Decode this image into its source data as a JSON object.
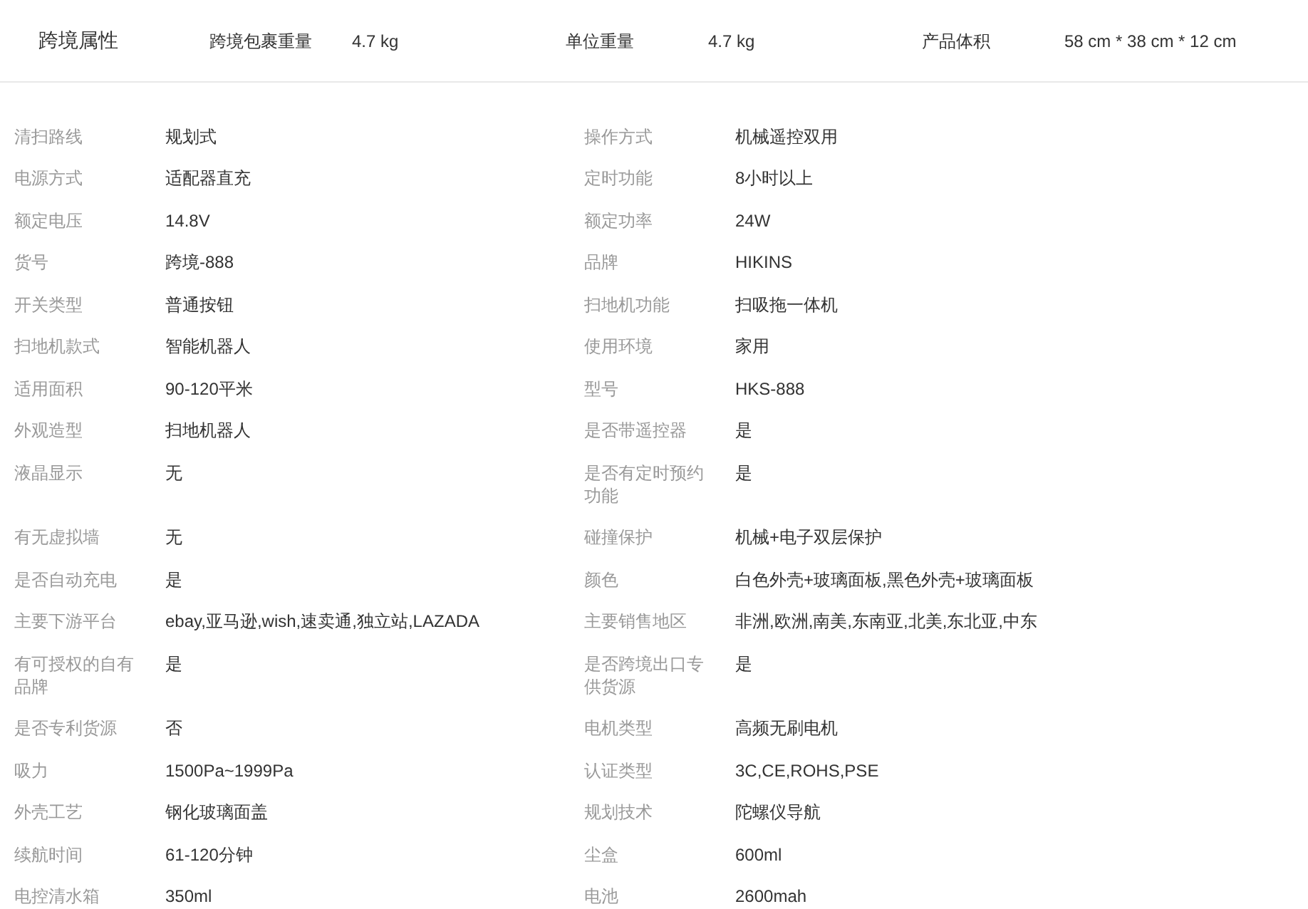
{
  "header": {
    "title": "跨境属性",
    "attributes": [
      {
        "label": "跨境包裹重量",
        "value": "4.7 kg"
      },
      {
        "label": "单位重量",
        "value": "4.7 kg"
      },
      {
        "label": "产品体积",
        "value": "58 cm * 38 cm * 12 cm"
      }
    ]
  },
  "specs": [
    {
      "label": "清扫路线",
      "value": "规划式"
    },
    {
      "label": "操作方式",
      "value": "机械遥控双用"
    },
    {
      "label": "电源方式",
      "value": "适配器直充"
    },
    {
      "label": "定时功能",
      "value": "8小时以上"
    },
    {
      "label": "额定电压",
      "value": "14.8V"
    },
    {
      "label": "额定功率",
      "value": "24W"
    },
    {
      "label": "货号",
      "value": "跨境-888"
    },
    {
      "label": "品牌",
      "value": "HIKINS"
    },
    {
      "label": "开关类型",
      "value": "普通按钮"
    },
    {
      "label": "扫地机功能",
      "value": "扫吸拖一体机"
    },
    {
      "label": "扫地机款式",
      "value": "智能机器人"
    },
    {
      "label": "使用环境",
      "value": "家用"
    },
    {
      "label": "适用面积",
      "value": "90-120平米"
    },
    {
      "label": "型号",
      "value": "HKS-888"
    },
    {
      "label": "外观造型",
      "value": "扫地机器人"
    },
    {
      "label": "是否带遥控器",
      "value": "是"
    },
    {
      "label": "液晶显示",
      "value": "无"
    },
    {
      "label": "是否有定时预约功能",
      "value": "是"
    },
    {
      "label": "有无虚拟墙",
      "value": "无"
    },
    {
      "label": "碰撞保护",
      "value": "机械+电子双层保护"
    },
    {
      "label": "是否自动充电",
      "value": "是"
    },
    {
      "label": "颜色",
      "value": "白色外壳+玻璃面板,黑色外壳+玻璃面板"
    },
    {
      "label": "主要下游平台",
      "value": "ebay,亚马逊,wish,速卖通,独立站,LAZADA"
    },
    {
      "label": "主要销售地区",
      "value": "非洲,欧洲,南美,东南亚,北美,东北亚,中东"
    },
    {
      "label": "有可授权的自有品牌",
      "value": "是"
    },
    {
      "label": "是否跨境出口专供货源",
      "value": "是"
    },
    {
      "label": "是否专利货源",
      "value": "否"
    },
    {
      "label": "电机类型",
      "value": "高频无刷电机"
    },
    {
      "label": "吸力",
      "value": "1500Pa~1999Pa"
    },
    {
      "label": "认证类型",
      "value": "3C,CE,ROHS,PSE"
    },
    {
      "label": "外壳工艺",
      "value": "钢化玻璃面盖"
    },
    {
      "label": "规划技术",
      "value": "陀螺仪导航"
    },
    {
      "label": "续航时间",
      "value": "61-120分钟"
    },
    {
      "label": "尘盒",
      "value": "600ml"
    },
    {
      "label": "电控清水箱",
      "value": "350ml"
    },
    {
      "label": "电池",
      "value": "2600mah"
    }
  ]
}
